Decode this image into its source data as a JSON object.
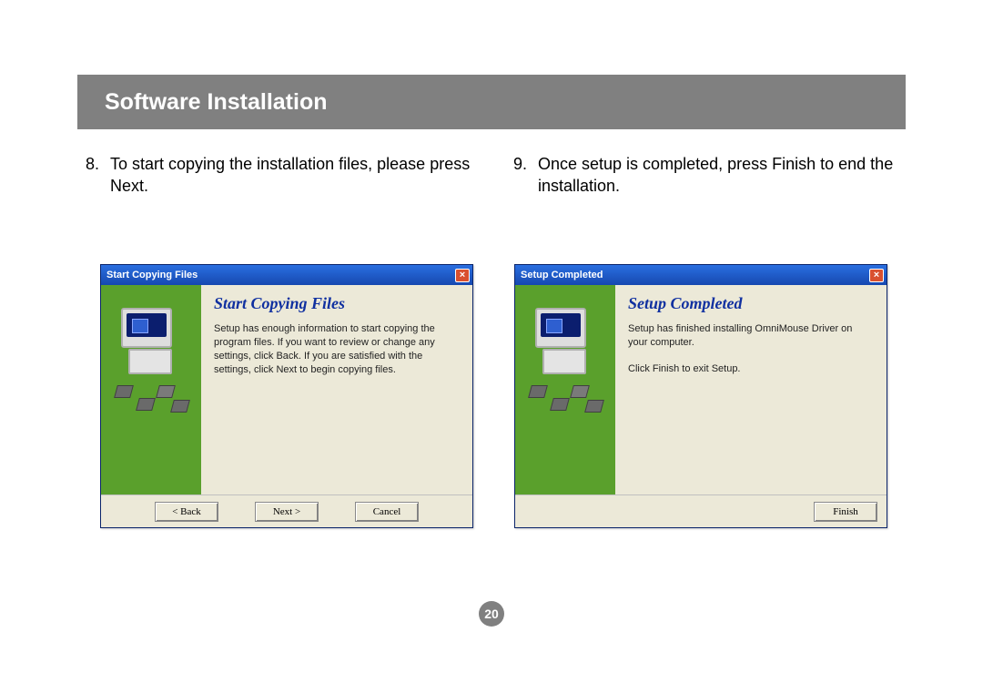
{
  "header": {
    "title": "Software Installation"
  },
  "instructions": {
    "step8": {
      "num": "8.",
      "text": "To start copying the installation files, please press Next."
    },
    "step9": {
      "num": "9.",
      "text": "Once setup is completed, press Finish to end the installation."
    }
  },
  "dialogs": {
    "left": {
      "titlebar": "Start Copying Files",
      "close": "×",
      "wiz_title": "Start Copying Files",
      "body1": "Setup has enough information to start copying the program files. If you want to review or change any settings, click Back. If you are satisfied with the settings, click Next to begin copying files.",
      "buttons": {
        "back": "< Back",
        "next": "Next >",
        "cancel": "Cancel"
      }
    },
    "right": {
      "titlebar": "Setup Completed",
      "close": "×",
      "wiz_title": "Setup Completed",
      "body1": "Setup has finished installing OmniMouse Driver on your computer.",
      "body2": "Click Finish to exit Setup.",
      "buttons": {
        "finish": "Finish"
      }
    }
  },
  "page_number": "20"
}
